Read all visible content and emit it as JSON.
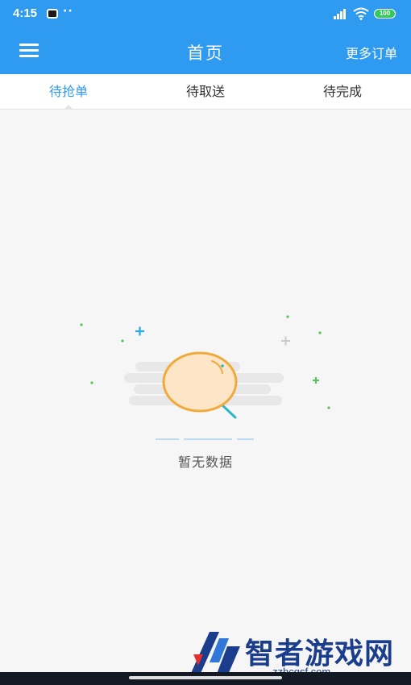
{
  "status_bar": {
    "time": "4:15",
    "dots": "··",
    "battery": "100"
  },
  "header": {
    "title": "首页",
    "more_orders": "更多订单"
  },
  "tabs": [
    {
      "label": "待抢单",
      "active": true
    },
    {
      "label": "待取送",
      "active": false
    },
    {
      "label": "待完成",
      "active": false
    }
  ],
  "empty_state": {
    "message": "暂无数据"
  },
  "watermark": {
    "text": "智者游戏网",
    "url": "zzhcgsf.com"
  },
  "colors": {
    "primary": "#2e9af0",
    "illustration_orange": "#f2a93b",
    "illustration_fill": "#fde6c8",
    "sparkle_green": "#5ac25a",
    "sparkle_blue": "#2aa9e0"
  },
  "icons": {
    "menu": "hamburger-menu-icon",
    "signal": "signal-icon",
    "wifi": "wifi-icon",
    "battery": "battery-icon",
    "empty": "magnifier-empty-icon"
  }
}
